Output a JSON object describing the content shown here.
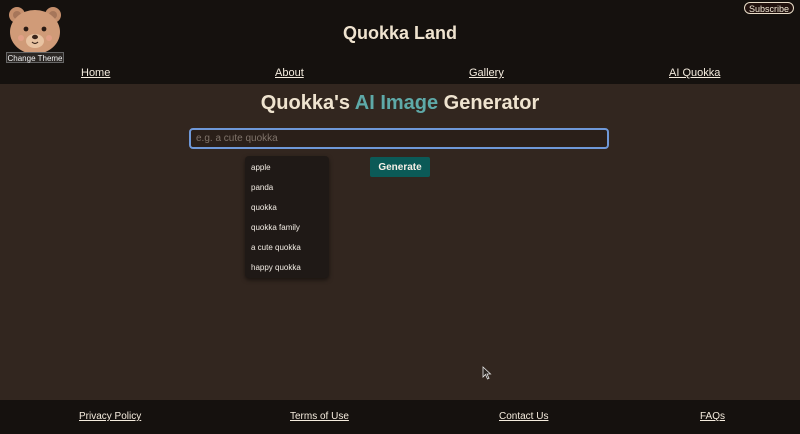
{
  "header": {
    "site_title": "Quokka Land",
    "theme_button": "Change Theme",
    "subscribe": "Subscribe"
  },
  "nav": {
    "home": "Home",
    "about": "About",
    "gallery": "Gallery",
    "ai_quokka": "AI Quokka"
  },
  "main": {
    "title_prefix": "Quokka's ",
    "title_accent": "AI Image",
    "title_suffix": " Generator",
    "search_placeholder": "e.g. a cute quokka",
    "generate_button": "Generate",
    "suggestions": [
      "apple",
      "panda",
      "quokka",
      "quokka family",
      "a cute quokka",
      "happy quokka"
    ]
  },
  "footer": {
    "privacy": "Privacy Policy",
    "terms": "Terms of Use",
    "contact": "Contact Us",
    "faqs": "FAQs"
  },
  "colors": {
    "background": "#32261f",
    "header_footer": "#15110e",
    "accent": "#5ea9a8",
    "button": "#0b5a57",
    "input_focus": "#6f98d8"
  },
  "icons": {
    "logo": "bear-face-icon",
    "cursor": "mouse-pointer-icon"
  }
}
